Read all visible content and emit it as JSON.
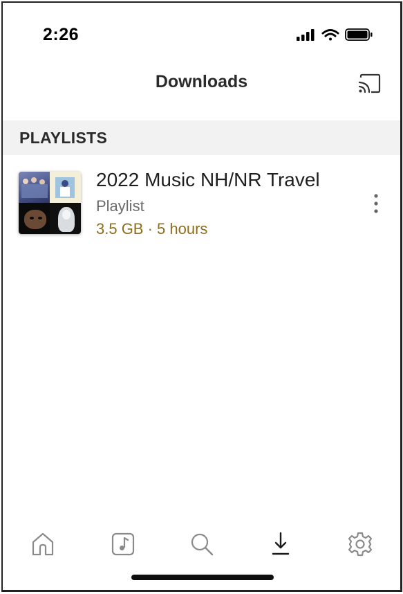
{
  "status_bar": {
    "time": "2:26",
    "icons": [
      "cellular-signal-icon",
      "wifi-icon",
      "battery-icon"
    ]
  },
  "nav": {
    "title": "Downloads",
    "cast_icon": "cast-icon"
  },
  "section": {
    "title": "PLAYLISTS"
  },
  "playlist": {
    "title": "2022 Music NH/NR Travel",
    "type": "Playlist",
    "meta": "3.5 GB · 5 hours",
    "more_icon": "more-vertical-icon"
  },
  "tabs": [
    {
      "icon": "home-icon",
      "selected": false
    },
    {
      "icon": "music-note-icon",
      "selected": false
    },
    {
      "icon": "search-icon",
      "selected": false
    },
    {
      "icon": "download-icon",
      "selected": true
    },
    {
      "icon": "settings-gear-icon",
      "selected": false
    }
  ],
  "colors": {
    "accent_meta": "#8e6d1a",
    "section_bg": "#f2f2f2",
    "tab_icon": "#8a8a8a",
    "tab_icon_selected": "#1a1a1a"
  }
}
